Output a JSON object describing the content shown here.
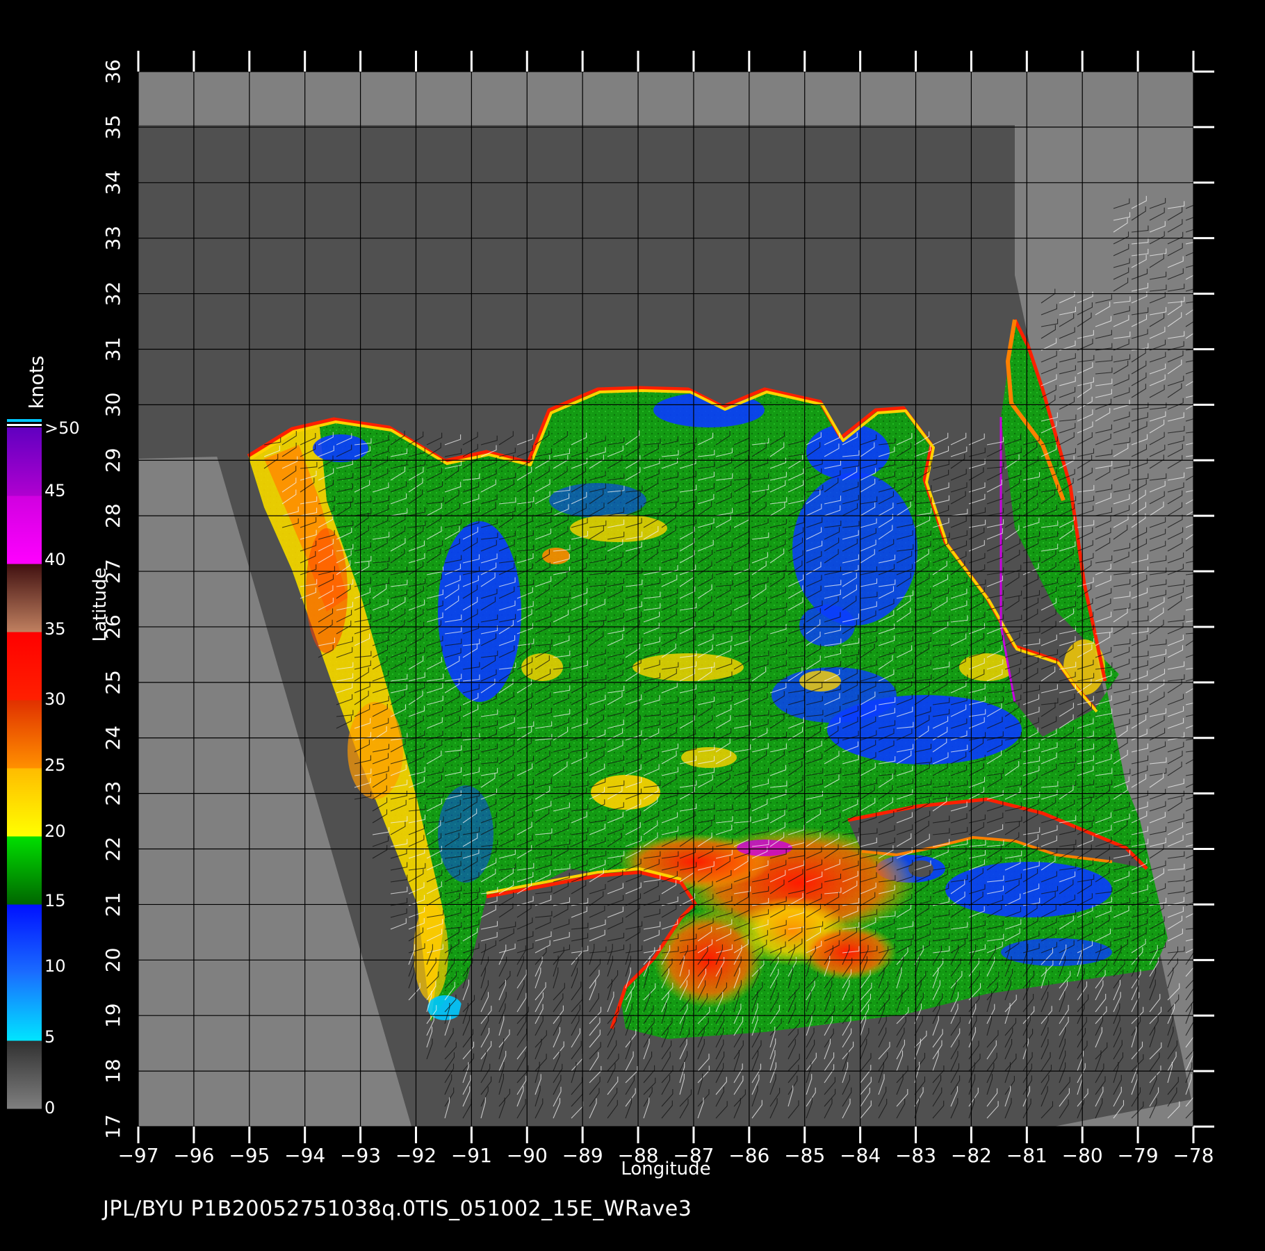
{
  "map": {
    "xlabel": "Longitude",
    "ylabel": "Latitude",
    "lon_ticks": [
      "-97",
      "-96",
      "-95",
      "-94",
      "-93",
      "-92",
      "-91",
      "-90",
      "-89",
      "-88",
      "-87",
      "-86",
      "-85",
      "-84",
      "-83",
      "-82",
      "-81",
      "-80",
      "-79",
      "-78"
    ],
    "lat_ticks": [
      "17",
      "18",
      "19",
      "20",
      "21",
      "22",
      "23",
      "24",
      "25",
      "26",
      "27",
      "28",
      "29",
      "30",
      "31",
      "32",
      "33",
      "34",
      "35",
      "36"
    ],
    "lon_range": [
      -97,
      -78
    ],
    "lat_range": [
      17,
      36
    ],
    "grid": true,
    "background_color": "#808080",
    "swath_color": "#505050",
    "grid_color": "#000000"
  },
  "colorbar": {
    "unit_label": "knots",
    "labels": [
      ">50",
      "45",
      "40",
      "35",
      "30",
      "25",
      "20",
      "15",
      "10",
      "5",
      "0"
    ],
    "stops": [
      {
        "label": "0-5",
        "colors": [
          "#7f7f7f",
          "#303030"
        ]
      },
      {
        "label": "5-10",
        "colors": [
          "#00e5ff",
          "#1a6cff"
        ]
      },
      {
        "label": "10-15",
        "colors": [
          "#1a6cff",
          "#0010ff"
        ]
      },
      {
        "label": "15-20",
        "colors": [
          "#006600",
          "#00e000"
        ]
      },
      {
        "label": "20-25",
        "colors": [
          "#ffff00",
          "#ffbb00"
        ]
      },
      {
        "label": "25-30",
        "colors": [
          "#ff9000",
          "#e03000"
        ]
      },
      {
        "label": "30-35",
        "colors": [
          "#ff2000",
          "#ff0000"
        ]
      },
      {
        "label": "35-40",
        "colors": [
          "#c08060",
          "#401010"
        ]
      },
      {
        "label": "40-45",
        "colors": [
          "#ff00ff",
          "#d000e0"
        ]
      },
      {
        "label": "45-50",
        "colors": [
          "#b000d0",
          "#6000c0"
        ]
      }
    ]
  },
  "footer": {
    "text": "JPL/BYU  P1B20052751038q.0TIS_051002_15E_WRave3"
  }
}
